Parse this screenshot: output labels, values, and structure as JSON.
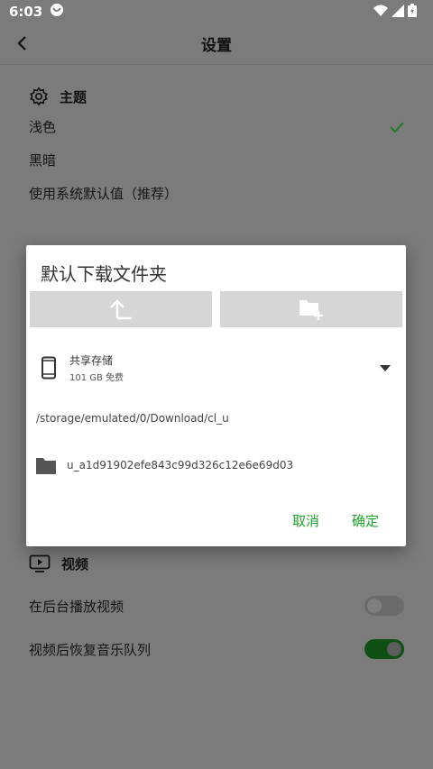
{
  "status": {
    "time": "6:03"
  },
  "appbar": {
    "title": "设置"
  },
  "theme": {
    "header": "主题",
    "options": [
      "浅色",
      "黑暗",
      "使用系统默认值（推荐）"
    ]
  },
  "video": {
    "header": "视频",
    "rows": [
      {
        "label": "在后台播放视频",
        "on": false
      },
      {
        "label": "视频后恢复音乐队列",
        "on": true
      }
    ]
  },
  "dialog": {
    "title": "默认下载文件夹",
    "storage_name": "共享存储",
    "storage_free": "101 GB 免费",
    "path": "/storage/emulated/0/Download/cl_u",
    "folder": "u_a1d91902efe843c99d326c12e6e69d03",
    "cancel": "取消",
    "confirm": "确定"
  },
  "colors": {
    "accent": "#1fa32d",
    "check": "#1f7d23"
  }
}
